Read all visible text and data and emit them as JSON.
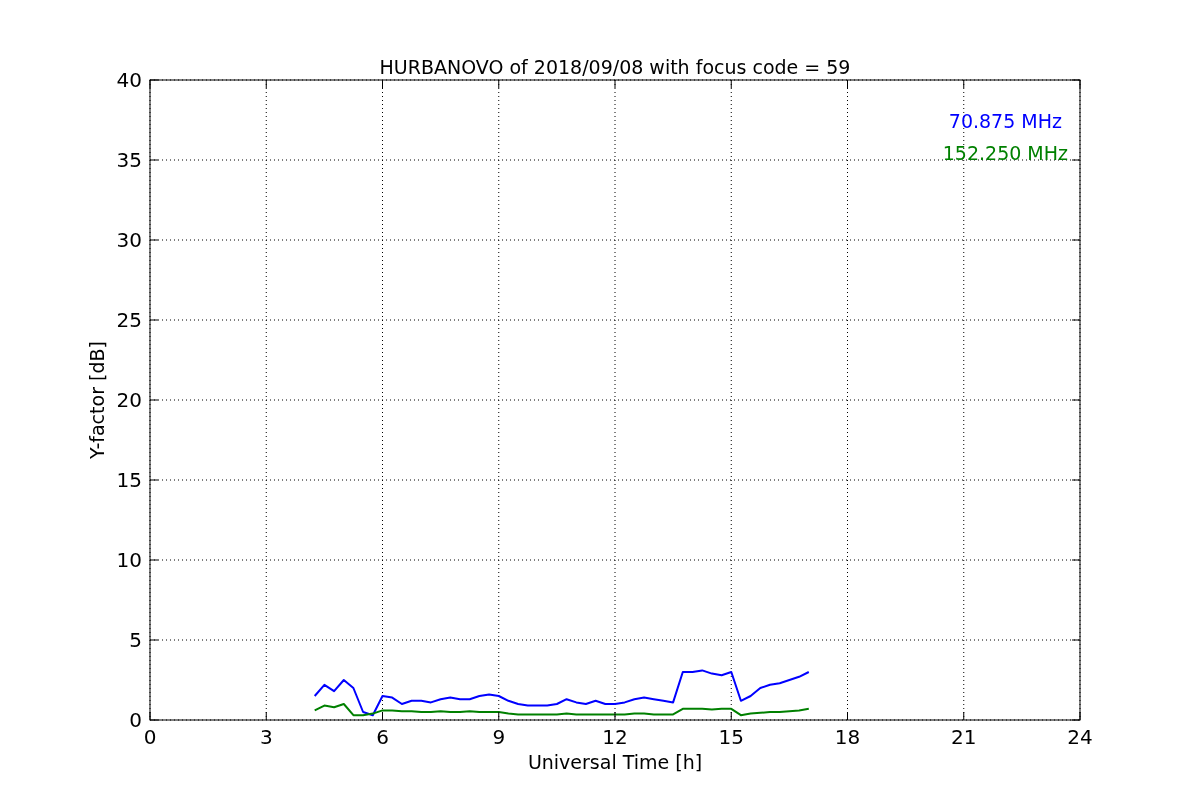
{
  "figure": {
    "chart_data": {
      "type": "line",
      "title": "HURBANOVO of 2018/09/08 with focus code = 59",
      "xlabel": "Universal Time [h]",
      "ylabel": "Y-factor [dB]",
      "x": [
        4.25,
        4.5,
        4.75,
        5.0,
        5.25,
        5.5,
        5.75,
        6.0,
        6.25,
        6.5,
        6.75,
        7.0,
        7.25,
        7.5,
        7.75,
        8.0,
        8.25,
        8.5,
        8.75,
        9.0,
        9.25,
        9.5,
        9.75,
        10.0,
        10.25,
        10.5,
        10.75,
        11.0,
        11.25,
        11.5,
        11.75,
        12.0,
        12.25,
        12.5,
        12.75,
        13.0,
        13.25,
        13.5,
        13.75,
        14.0,
        14.25,
        14.5,
        14.75,
        15.0,
        15.25,
        15.5,
        15.75,
        16.0,
        16.25,
        16.5,
        16.75,
        17.0
      ],
      "series": [
        {
          "name": "70.875 MHz",
          "color": "#0000ff",
          "values": [
            1.5,
            2.2,
            1.8,
            2.5,
            2.0,
            0.5,
            0.3,
            1.5,
            1.4,
            1.0,
            1.2,
            1.2,
            1.1,
            1.3,
            1.4,
            1.3,
            1.3,
            1.5,
            1.6,
            1.5,
            1.2,
            1.0,
            0.9,
            0.9,
            0.9,
            1.0,
            1.3,
            1.1,
            1.0,
            1.2,
            1.0,
            1.0,
            1.1,
            1.3,
            1.4,
            1.3,
            1.2,
            1.1,
            3.0,
            3.0,
            3.1,
            2.9,
            2.8,
            3.0,
            1.2,
            1.5,
            2.0,
            2.2,
            2.3,
            2.5,
            2.7,
            3.0
          ]
        },
        {
          "name": "152.250 MHz",
          "color": "#008000",
          "values": [
            0.6,
            0.9,
            0.8,
            1.0,
            0.3,
            0.3,
            0.4,
            0.6,
            0.6,
            0.55,
            0.55,
            0.5,
            0.5,
            0.55,
            0.5,
            0.5,
            0.55,
            0.5,
            0.5,
            0.5,
            0.4,
            0.35,
            0.35,
            0.35,
            0.35,
            0.35,
            0.4,
            0.35,
            0.35,
            0.35,
            0.35,
            0.35,
            0.35,
            0.4,
            0.4,
            0.35,
            0.35,
            0.35,
            0.7,
            0.7,
            0.7,
            0.65,
            0.7,
            0.7,
            0.3,
            0.4,
            0.45,
            0.5,
            0.5,
            0.55,
            0.6,
            0.7
          ]
        }
      ],
      "xlim": [
        0,
        24
      ],
      "ylim": [
        0,
        40
      ],
      "xticks": [
        0,
        3,
        6,
        9,
        12,
        15,
        18,
        21,
        24
      ],
      "yticks": [
        0,
        5,
        10,
        15,
        20,
        25,
        30,
        35,
        40
      ],
      "grid": true
    }
  }
}
